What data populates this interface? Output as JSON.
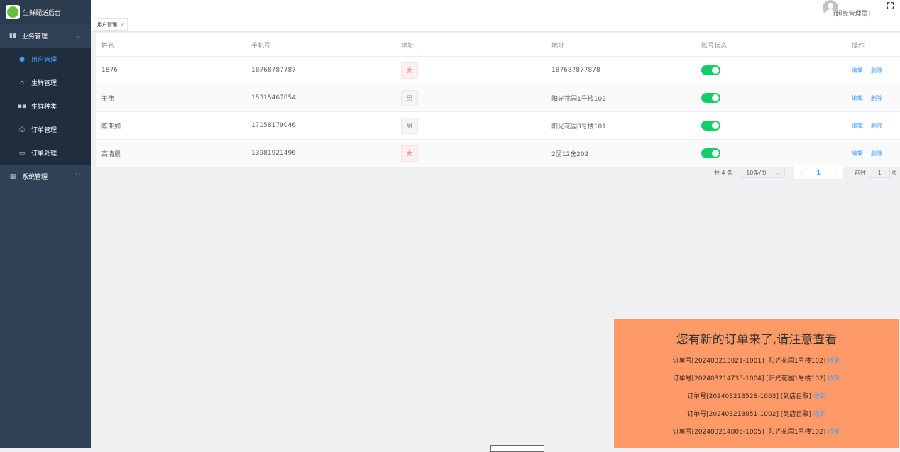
{
  "app": {
    "title": "生鲜配送后台"
  },
  "sidebar": {
    "groups": [
      {
        "label": "业务管理",
        "icon": "bar-chart-icon",
        "expanded": true
      },
      {
        "label": "系统管理",
        "icon": "grid-icon",
        "expanded": false
      }
    ],
    "items": [
      {
        "label": "用户管理",
        "icon": "user-icon",
        "active": true
      },
      {
        "label": "生鲜管理",
        "icon": "bag-icon"
      },
      {
        "label": "生鲜种类",
        "icon": "category-icon"
      },
      {
        "label": "订单管理",
        "icon": "printer-icon"
      },
      {
        "label": "订单处理",
        "icon": "box-icon"
      }
    ]
  },
  "header": {
    "user_label": "[超级管理员]",
    "fullscreen_icon": "fullscreen-icon"
  },
  "tags": {
    "active": "用户管理",
    "close": "×"
  },
  "table": {
    "columns": [
      "姓名",
      "手机号",
      "地址",
      "地址",
      "账号状态",
      "操作"
    ],
    "rows": [
      {
        "name": "1876",
        "phone": "18768787787",
        "gender": "女",
        "address": "187687877878",
        "enabled": true
      },
      {
        "name": "王伟",
        "phone": "15315467854",
        "gender": "男",
        "address": "阳光花园1号楼102",
        "enabled": true
      },
      {
        "name": "陈亚如",
        "phone": "17058179046",
        "gender": "男",
        "address": "阳光花园8号楼101",
        "enabled": true
      },
      {
        "name": "高清晨",
        "phone": "13981921496",
        "gender": "女",
        "address": "2区12舍202",
        "enabled": true
      }
    ],
    "actions": {
      "edit": "编辑",
      "delete": "删除"
    }
  },
  "pagination": {
    "total": "共 4 条",
    "page_size": "10条/页",
    "prev": "‹",
    "current": "1",
    "next": "›",
    "goto": "前往",
    "goto_value": "1",
    "page_suffix": "页"
  },
  "notice": {
    "title": "您有新的订单来了,请注意查看",
    "orders": [
      {
        "text": "订单号[202403213021-1001] [阳光花园1号楼102]",
        "action": "收到"
      },
      {
        "text": "订单号[202403214735-1004] [阳光花园1号楼102]",
        "action": "收到"
      },
      {
        "text": "订单号[202403213528-1003] [到店自取]",
        "action": "收到"
      },
      {
        "text": "订单号[202403213051-1002] [到店自取]",
        "action": "收到"
      },
      {
        "text": "订单号[202403214805-1005] [阳光花园1号楼102]",
        "action": "收到"
      }
    ]
  },
  "colors": {
    "sidebar": "#304156",
    "accent": "#409eff",
    "switch_on": "#13ce66",
    "notice_bg": "#fe9a67"
  }
}
